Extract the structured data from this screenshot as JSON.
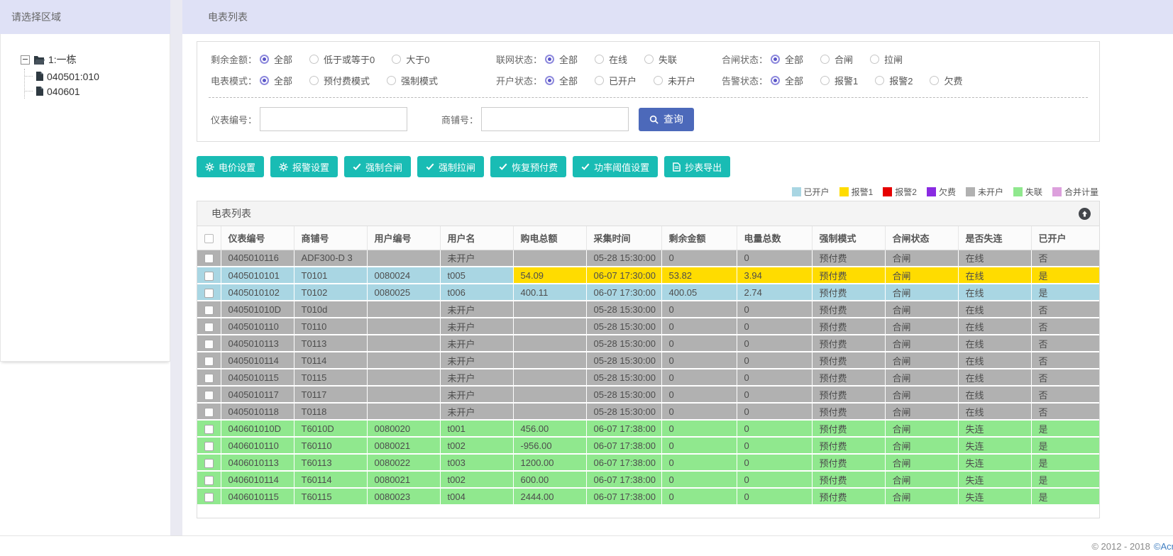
{
  "sidebar": {
    "title": "请选择区域",
    "tree": {
      "root": {
        "label": "1:一栋",
        "expanded": true
      },
      "children": [
        {
          "label": "040501:010"
        },
        {
          "label": "040601"
        }
      ]
    }
  },
  "main": {
    "title": "电表列表",
    "filters": {
      "rows": [
        {
          "groups": [
            {
              "label": "剩余金额：",
              "options": [
                "全部",
                "低于或等于0",
                "大于0"
              ],
              "selected": 0
            },
            {
              "label": "联网状态：",
              "options": [
                "全部",
                "在线",
                "失联"
              ],
              "selected": 0
            },
            {
              "label": "合闸状态：",
              "options": [
                "全部",
                "合闸",
                "拉闸"
              ],
              "selected": 0
            }
          ]
        },
        {
          "groups": [
            {
              "label": "电表模式：",
              "options": [
                "全部",
                "预付费模式",
                "强制模式"
              ],
              "selected": 0
            },
            {
              "label": "开户状态：",
              "options": [
                "全部",
                "已开户",
                "未开户"
              ],
              "selected": 0
            },
            {
              "label": "告警状态：",
              "options": [
                "全部",
                "报警1",
                "报警2",
                "欠费"
              ],
              "selected": 0
            }
          ]
        }
      ],
      "meter_no_label": "仪表编号：",
      "meter_no_value": "",
      "shop_no_label": "商铺号：",
      "shop_no_value": "",
      "search_label": "查询"
    },
    "actions": [
      {
        "icon": "gear-icon",
        "label": "电价设置"
      },
      {
        "icon": "gear-icon",
        "label": "报警设置"
      },
      {
        "icon": "check-icon",
        "label": "强制合闸"
      },
      {
        "icon": "check-icon",
        "label": "强制拉闸"
      },
      {
        "icon": "check-icon",
        "label": "恢复预付费"
      },
      {
        "icon": "check-icon",
        "label": "功率阈值设置"
      },
      {
        "icon": "export-icon",
        "label": "抄表导出"
      }
    ],
    "legend": [
      {
        "label": "已开户",
        "color": "#a9d6e3"
      },
      {
        "label": "报警1",
        "color": "#ffdc00"
      },
      {
        "label": "报警2",
        "color": "#e60000"
      },
      {
        "label": "欠费",
        "color": "#8a2be2"
      },
      {
        "label": "未开户",
        "color": "#b1b1b1"
      },
      {
        "label": "失联",
        "color": "#90e88e"
      },
      {
        "label": "合并计量",
        "color": "#dda0dd"
      }
    ],
    "table": {
      "title": "电表列表",
      "columns": [
        "仪表编号",
        "商铺号",
        "用户编号",
        "用户名",
        "购电总额",
        "采集时间",
        "剩余金额",
        "电量总数",
        "强制模式",
        "合闸状态",
        "是否失连",
        "已开户"
      ],
      "rows": [
        {
          "status": "未开户",
          "cells": [
            "0405010116",
            "ADF300-D 3",
            "",
            "未开户",
            "",
            "05-28 15:30:00",
            "0",
            "0",
            "预付费",
            "合闸",
            "在线",
            "否"
          ]
        },
        {
          "status": "报警1",
          "split": {
            "index": 4,
            "left": "已开户",
            "right": "报警1"
          },
          "cells": [
            "0405010101",
            "T0101",
            "0080024",
            "t005",
            "54.09",
            "06-07 17:30:00",
            "53.82",
            "3.94",
            "预付费",
            "合闸",
            "在线",
            "是"
          ]
        },
        {
          "status": "已开户",
          "cells": [
            "0405010102",
            "T0102",
            "0080025",
            "t006",
            "400.11",
            "06-07 17:30:00",
            "400.05",
            "2.74",
            "预付费",
            "合闸",
            "在线",
            "是"
          ]
        },
        {
          "status": "未开户",
          "cells": [
            "040501010D",
            "T010d",
            "",
            "未开户",
            "",
            "05-28 15:30:00",
            "0",
            "0",
            "预付费",
            "合闸",
            "在线",
            "否"
          ]
        },
        {
          "status": "未开户",
          "cells": [
            "0405010110",
            "T0110",
            "",
            "未开户",
            "",
            "05-28 15:30:00",
            "0",
            "0",
            "预付费",
            "合闸",
            "在线",
            "否"
          ]
        },
        {
          "status": "未开户",
          "cells": [
            "0405010113",
            "T0113",
            "",
            "未开户",
            "",
            "05-28 15:30:00",
            "0",
            "0",
            "预付费",
            "合闸",
            "在线",
            "否"
          ]
        },
        {
          "status": "未开户",
          "cells": [
            "0405010114",
            "T0114",
            "",
            "未开户",
            "",
            "05-28 15:30:00",
            "0",
            "0",
            "预付费",
            "合闸",
            "在线",
            "否"
          ]
        },
        {
          "status": "未开户",
          "cells": [
            "0405010115",
            "T0115",
            "",
            "未开户",
            "",
            "05-28 15:30:00",
            "0",
            "0",
            "预付费",
            "合闸",
            "在线",
            "否"
          ]
        },
        {
          "status": "未开户",
          "cells": [
            "0405010117",
            "T0117",
            "",
            "未开户",
            "",
            "05-28 15:30:00",
            "0",
            "0",
            "预付费",
            "合闸",
            "在线",
            "否"
          ]
        },
        {
          "status": "未开户",
          "cells": [
            "0405010118",
            "T0118",
            "",
            "未开户",
            "",
            "05-28 15:30:00",
            "0",
            "0",
            "预付费",
            "合闸",
            "在线",
            "否"
          ]
        },
        {
          "status": "失联",
          "cells": [
            "040601010D",
            "T6010D",
            "0080020",
            "t001",
            "456.00",
            "06-07 17:38:00",
            "0",
            "0",
            "预付费",
            "合闸",
            "失连",
            "是"
          ]
        },
        {
          "status": "失联",
          "cells": [
            "0406010110",
            "T60110",
            "0080021",
            "t002",
            "-956.00",
            "06-07 17:38:00",
            "0",
            "0",
            "预付费",
            "合闸",
            "失连",
            "是"
          ]
        },
        {
          "status": "失联",
          "cells": [
            "0406010113",
            "T60113",
            "0080022",
            "t003",
            "1200.00",
            "06-07 17:38:00",
            "0",
            "0",
            "预付费",
            "合闸",
            "失连",
            "是"
          ]
        },
        {
          "status": "失联",
          "cells": [
            "0406010114",
            "T60114",
            "0080021",
            "t002",
            "600.00",
            "06-07 17:38:00",
            "0",
            "0",
            "预付费",
            "合闸",
            "失连",
            "是"
          ]
        },
        {
          "status": "失联",
          "cells": [
            "0406010115",
            "T60115",
            "0080023",
            "t004",
            "2444.00",
            "06-07 17:38:00",
            "0",
            "0",
            "预付费",
            "合闸",
            "失连",
            "是"
          ]
        }
      ]
    }
  },
  "footer": {
    "copyright_prefix": "© 2012 - 2018",
    "copyright_link": "©Acr"
  }
}
